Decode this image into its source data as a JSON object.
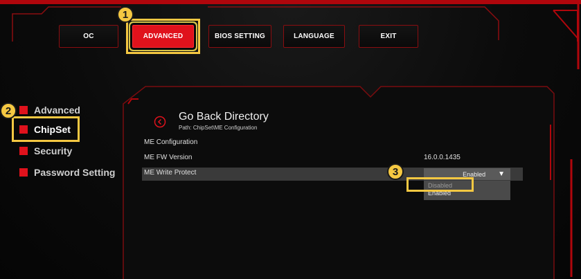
{
  "tabs": [
    {
      "label": "OC",
      "active": false
    },
    {
      "label": "ADVANCED",
      "active": true
    },
    {
      "label": "BIOS SETTING",
      "active": false
    },
    {
      "label": "LANGUAGE",
      "active": false
    },
    {
      "label": "EXIT",
      "active": false
    }
  ],
  "badges": {
    "one": "1",
    "two": "2",
    "three": "3"
  },
  "sidebar": {
    "items": [
      {
        "label": "Advanced",
        "active": false
      },
      {
        "label": "ChipSet",
        "active": true
      },
      {
        "label": "Security",
        "active": false
      },
      {
        "label": "Password Setting",
        "active": false
      }
    ]
  },
  "main": {
    "back_title": "Go Back Directory",
    "path": "Path: ChipSet\\ME Configuration",
    "rows": {
      "me_config_label": "ME Configuration",
      "fw_label": "ME FW Version",
      "fw_value": "16.0.0.1435",
      "write_protect_label": "ME Write Protect",
      "write_protect_value": "Enabled"
    },
    "dropdown": {
      "options": [
        "Disabled",
        "Enabled"
      ]
    }
  },
  "colors": {
    "accent_red": "#e0121c",
    "highlight_yellow": "#f5c842",
    "frame_red": "#8b0d10"
  },
  "icons": {
    "back": "chevron-left-circle-icon",
    "select_arrow": "triangle-down-icon"
  }
}
